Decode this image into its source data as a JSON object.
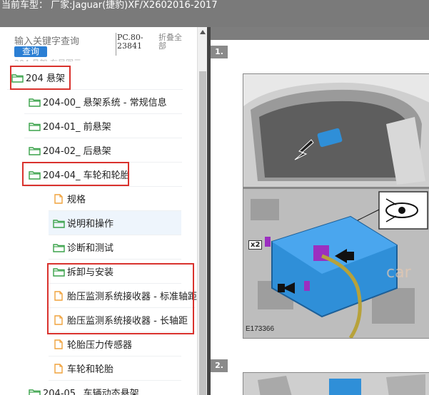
{
  "header": {
    "text": "当前车型： 厂家:Jaguar(捷豹)XF/X2602016-2017"
  },
  "search": {
    "placeholder": "输入关键字查询",
    "button": "查询",
    "pc_code": "PC.80-23841",
    "collapse": "折叠全部",
    "faint_text": "204 悬架 布局图示"
  },
  "tree": [
    {
      "label": "204 悬架",
      "type": "folder"
    },
    {
      "label": "204-00_ 悬架系统 - 常规信息",
      "type": "folder"
    },
    {
      "label": "204-01_ 前悬架",
      "type": "folder"
    },
    {
      "label": "204-02_ 后悬架",
      "type": "folder"
    },
    {
      "label": "204-04_ 车轮和轮胎",
      "type": "folder"
    },
    {
      "label": "规格",
      "type": "doc"
    },
    {
      "label": "说明和操作",
      "type": "folder"
    },
    {
      "label": "诊断和测试",
      "type": "folder"
    },
    {
      "label": "拆卸与安装",
      "type": "folder"
    },
    {
      "label": "胎压监测系统接收器 - 标准轴距",
      "type": "doc"
    },
    {
      "label": "胎压监测系统接收器 - 长轴距",
      "type": "doc"
    },
    {
      "label": "轮胎压力传感器",
      "type": "doc"
    },
    {
      "label": "车轮和轮胎",
      "type": "doc"
    },
    {
      "label": "204-05_ 车辆动态悬架",
      "type": "folder"
    }
  ],
  "viewer": {
    "step1": "1.",
    "step2": "2.",
    "figure_id": "E173366",
    "callout": "x2"
  },
  "colors": {
    "topbar": "#7a7a7a",
    "folder_icon": "#3aa24a",
    "doc_icon": "#f0a23c",
    "highlight_box": "#d9322d",
    "search_button": "#2b7fd4",
    "module_blue": "#2f8fd8",
    "connector_purple": "#9b2fc0"
  }
}
